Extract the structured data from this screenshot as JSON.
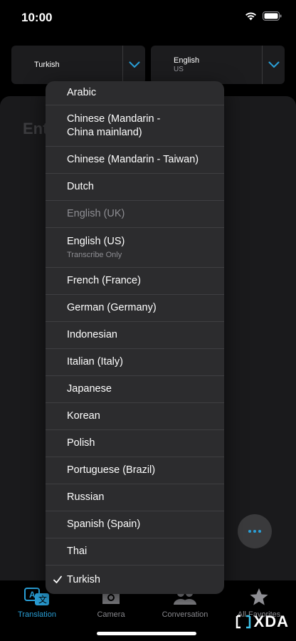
{
  "status_bar": {
    "time": "10:00"
  },
  "language_bar": {
    "source": {
      "name": "Turkish"
    },
    "target": {
      "name": "English",
      "region": "US"
    }
  },
  "main": {
    "placeholder": "Ent"
  },
  "dropdown": {
    "items": [
      {
        "label": "Arabic"
      },
      {
        "label": "Chinese (Mandarin - China mainland)"
      },
      {
        "label": "Chinese (Mandarin - Taiwan)"
      },
      {
        "label": "Dutch"
      },
      {
        "label": "English (UK)",
        "disabled": true
      },
      {
        "label": "English (US)",
        "sublabel": "Transcribe Only"
      },
      {
        "label": "French (France)"
      },
      {
        "label": "German (Germany)"
      },
      {
        "label": "Indonesian"
      },
      {
        "label": "Italian (Italy)"
      },
      {
        "label": "Japanese"
      },
      {
        "label": "Korean"
      },
      {
        "label": "Polish"
      },
      {
        "label": "Portuguese (Brazil)"
      },
      {
        "label": "Russian"
      },
      {
        "label": "Spanish (Spain)"
      },
      {
        "label": "Thai"
      },
      {
        "label": "Turkish",
        "selected": true
      }
    ]
  },
  "tabs": [
    {
      "label": "Translation",
      "icon": "translation-icon",
      "active": true
    },
    {
      "label": "Camera",
      "icon": "camera-icon"
    },
    {
      "label": "Conversation",
      "icon": "conversation-icon"
    },
    {
      "label": "All Favorites",
      "icon": "star-icon"
    }
  ],
  "watermark": {
    "text": "XDA"
  },
  "colors": {
    "accent": "#2aa0d8",
    "background": "#000000",
    "menu": "#2c2c2e"
  }
}
